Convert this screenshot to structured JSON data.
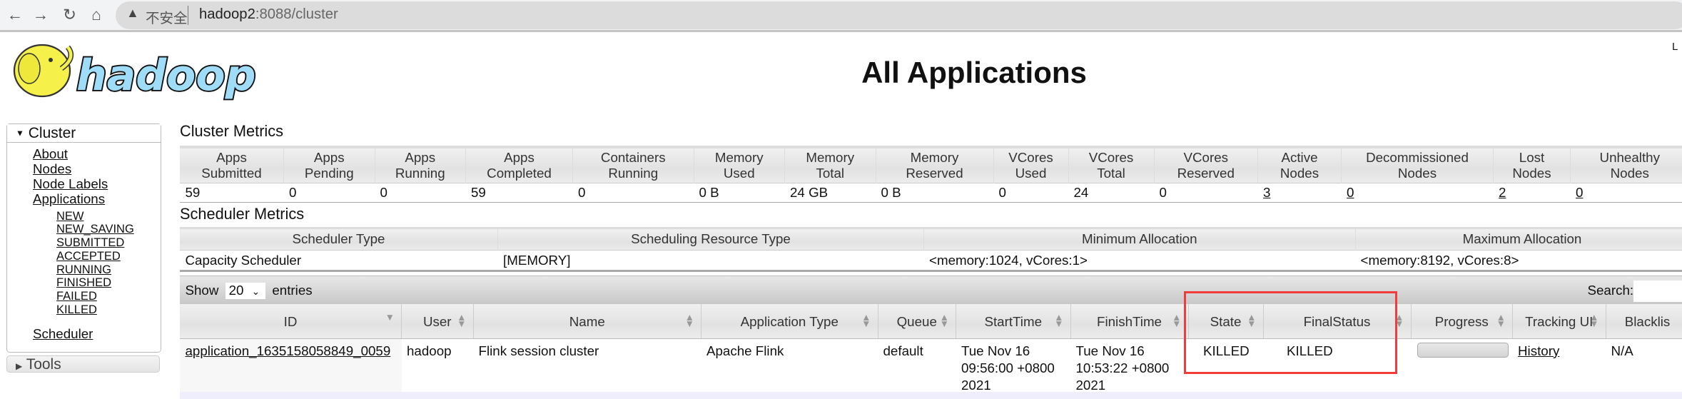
{
  "browser": {
    "insecure_label": "不安全",
    "url_host": "hadoop2",
    "url_rest": ":8088/cluster",
    "icons": [
      "back-icon",
      "forward-icon",
      "reload-icon",
      "home-icon",
      "warning-icon"
    ]
  },
  "header": {
    "logo_text": "hadoop",
    "title": "All Applications",
    "login_partial": "L"
  },
  "sidebar": {
    "cluster_label": "Cluster",
    "links": [
      "About",
      "Nodes",
      "Node Labels",
      "Applications"
    ],
    "states": [
      "NEW",
      "NEW_SAVING",
      "SUBMITTED",
      "ACCEPTED",
      "RUNNING",
      "FINISHED",
      "FAILED",
      "KILLED"
    ],
    "scheduler": "Scheduler",
    "tools_label": "Tools"
  },
  "cluster_metrics": {
    "title": "Cluster Metrics",
    "headers": [
      [
        "Apps",
        "Submitted"
      ],
      [
        "Apps",
        "Pending"
      ],
      [
        "Apps",
        "Running"
      ],
      [
        "Apps",
        "Completed"
      ],
      [
        "Containers",
        "Running"
      ],
      [
        "Memory",
        "Used"
      ],
      [
        "Memory",
        "Total"
      ],
      [
        "Memory",
        "Reserved"
      ],
      [
        "VCores",
        "Used"
      ],
      [
        "VCores",
        "Total"
      ],
      [
        "VCores",
        "Reserved"
      ],
      [
        "Active",
        "Nodes"
      ],
      [
        "Decommissioned",
        "Nodes"
      ],
      [
        "Lost",
        "Nodes"
      ],
      [
        "Unhealthy",
        "Nodes"
      ]
    ],
    "values": [
      "59",
      "0",
      "0",
      "59",
      "0",
      "0 B",
      "24 GB",
      "0 B",
      "0",
      "24",
      "0",
      "3",
      "0",
      "2",
      "0"
    ]
  },
  "scheduler_metrics": {
    "title": "Scheduler Metrics",
    "headers": [
      "Scheduler Type",
      "Scheduling Resource Type",
      "Minimum Allocation",
      "Maximum Allocation"
    ],
    "values": [
      "Capacity Scheduler",
      "[MEMORY]",
      "<memory:1024, vCores:1>",
      "<memory:8192, vCores:8>"
    ]
  },
  "apps_table": {
    "show_label": "Show",
    "entries_value": "20",
    "entries_label": "entries",
    "search_label": "Search:",
    "search_value": "",
    "headers": [
      "ID",
      "User",
      "Name",
      "Application Type",
      "Queue",
      "StartTime",
      "FinishTime",
      "State",
      "FinalStatus",
      "Progress",
      "Tracking UI",
      "Blacklis"
    ],
    "rows": [
      {
        "id": "application_1635158058849_0059",
        "user": "hadoop",
        "name": "Flink session cluster",
        "type": "Apache Flink",
        "queue": "default",
        "start": "Tue Nov 16 09:56:00 +0800 2021",
        "finish": "Tue Nov 16 10:53:22 +0800 2021",
        "state": "KILLED",
        "final_status": "KILLED",
        "progress": 0,
        "tracking": "History",
        "blacklisted": "N/A"
      }
    ]
  },
  "highlight_color": "#f23c3c"
}
